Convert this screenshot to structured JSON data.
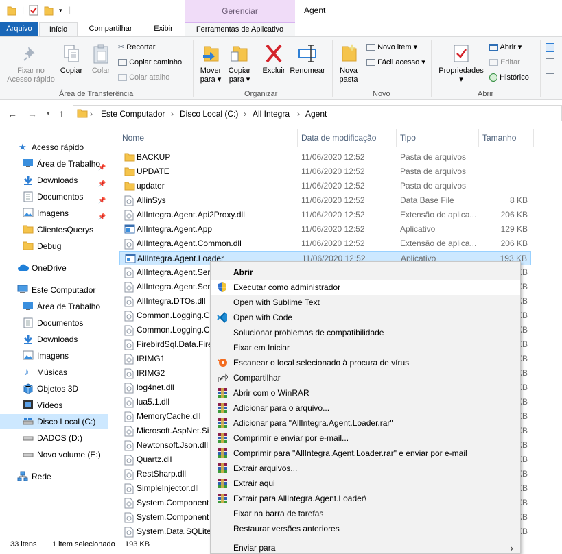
{
  "window": {
    "title": "Agent",
    "context_group": "Gerenciar"
  },
  "tabs": {
    "file": "Arquivo",
    "home": "Início",
    "share": "Compartilhar",
    "view": "Exibir",
    "tools": "Ferramentas de Aplicativo"
  },
  "ribbon": {
    "pin_quick_access": [
      "Fixar no",
      "Acesso rápido"
    ],
    "copy": "Copiar",
    "paste": "Colar",
    "cut": "Recortar",
    "copy_path": "Copiar caminho",
    "paste_shortcut": "Colar atalho",
    "group_clipboard": "Área de Transferência",
    "move_to": [
      "Mover",
      "para"
    ],
    "copy_to": [
      "Copiar",
      "para"
    ],
    "delete": "Excluir",
    "rename": "Renomear",
    "group_organize": "Organizar",
    "new_folder": [
      "Nova",
      "pasta"
    ],
    "new_item": "Novo item",
    "easy_access": "Fácil acesso",
    "group_new": "Novo",
    "properties": "Propriedades",
    "open": "Abrir",
    "edit": "Editar",
    "history": "Histórico",
    "group_open": "Abrir"
  },
  "address": {
    "crumbs": [
      "Este Computador",
      "Disco Local (C:)",
      "All Integra",
      "Agent"
    ]
  },
  "nav": {
    "quick_access": "Acesso rápido",
    "quick_items": [
      "Área de Trabalho",
      "Downloads",
      "Documentos",
      "Imagens",
      "ClientesQuerys",
      "Debug"
    ],
    "onedrive": "OneDrive",
    "this_pc": "Este Computador",
    "pc_items": [
      "Área de Trabalho",
      "Documentos",
      "Downloads",
      "Imagens",
      "Músicas",
      "Objetos 3D",
      "Vídeos",
      "Disco Local (C:)",
      "DADOS (D:)",
      "Novo volume (E:)"
    ],
    "network": "Rede"
  },
  "columns": {
    "name": "Nome",
    "date": "Data de modificação",
    "type": "Tipo",
    "size": "Tamanho"
  },
  "files": [
    {
      "name": "BACKUP",
      "date": "11/06/2020 12:52",
      "type": "Pasta de arquivos",
      "size": ""
    },
    {
      "name": "UPDATE",
      "date": "11/06/2020 12:52",
      "type": "Pasta de arquivos",
      "size": ""
    },
    {
      "name": "updater",
      "date": "11/06/2020 12:52",
      "type": "Pasta de arquivos",
      "size": ""
    },
    {
      "name": "AllinSys",
      "date": "11/06/2020 12:52",
      "type": "Data Base File",
      "size": "8 KB"
    },
    {
      "name": "AllIntegra.Agent.Api2Proxy.dll",
      "date": "11/06/2020 12:52",
      "type": "Extensão de aplica...",
      "size": "206 KB"
    },
    {
      "name": "AllIntegra.Agent.App",
      "date": "11/06/2020 12:52",
      "type": "Aplicativo",
      "size": "129 KB"
    },
    {
      "name": "AllIntegra.Agent.Common.dll",
      "date": "11/06/2020 12:52",
      "type": "Extensão de aplica...",
      "size": "206 KB"
    },
    {
      "name": "AllIntegra.Agent.Loader",
      "date": "11/06/2020 12:52",
      "type": "Aplicativo",
      "size": "193 KB"
    },
    {
      "name": "AllIntegra.Agent.Ser",
      "date": "",
      "type": "",
      "size": "KB"
    },
    {
      "name": "AllIntegra.Agent.Ser",
      "date": "",
      "type": "",
      "size": "KB"
    },
    {
      "name": "AllIntegra.DTOs.dll",
      "date": "",
      "type": "",
      "size": "KB"
    },
    {
      "name": "Common.Logging.C",
      "date": "",
      "type": "",
      "size": "KB"
    },
    {
      "name": "Common.Logging.C",
      "date": "",
      "type": "",
      "size": "KB"
    },
    {
      "name": "FirebirdSql.Data.Fire",
      "date": "",
      "type": "",
      "size": "KB"
    },
    {
      "name": "IRIMG1",
      "date": "",
      "type": "",
      "size": "KB"
    },
    {
      "name": "IRIMG2",
      "date": "",
      "type": "",
      "size": "KB"
    },
    {
      "name": "log4net.dll",
      "date": "",
      "type": "",
      "size": "KB"
    },
    {
      "name": "lua5.1.dll",
      "date": "",
      "type": "",
      "size": "KB"
    },
    {
      "name": "MemoryCache.dll",
      "date": "",
      "type": "",
      "size": "KB"
    },
    {
      "name": "Microsoft.AspNet.Si",
      "date": "",
      "type": "",
      "size": "KB"
    },
    {
      "name": "Newtonsoft.Json.dll",
      "date": "",
      "type": "",
      "size": "KB"
    },
    {
      "name": "Quartz.dll",
      "date": "",
      "type": "",
      "size": "KB"
    },
    {
      "name": "RestSharp.dll",
      "date": "",
      "type": "",
      "size": "KB"
    },
    {
      "name": "SimpleInjector.dll",
      "date": "",
      "type": "",
      "size": "KB"
    },
    {
      "name": "System.Component",
      "date": "",
      "type": "",
      "size": "KB"
    },
    {
      "name": "System.Component",
      "date": "",
      "type": "",
      "size": "KB"
    },
    {
      "name": "System.Data.SQLite.",
      "date": "",
      "type": "",
      "size": "KB"
    }
  ],
  "context_menu": [
    {
      "label": "Abrir",
      "icon": "none"
    },
    {
      "label": "Executar como administrador",
      "icon": "uac-shield-icon"
    },
    {
      "label": "Open with Sublime Text",
      "icon": "none"
    },
    {
      "label": "Open with Code",
      "icon": "vscode-icon"
    },
    {
      "label": "Solucionar problemas de compatibilidade",
      "icon": "none"
    },
    {
      "label": "Fixar em Iniciar",
      "icon": "none"
    },
    {
      "label": "Escanear o local selecionado à procura de vírus",
      "icon": "avast-icon"
    },
    {
      "label": "Compartilhar",
      "icon": "share-icon"
    },
    {
      "label": "Abrir com o WinRAR",
      "icon": "winrar-icon"
    },
    {
      "label": "Adicionar para o arquivo...",
      "icon": "winrar-icon"
    },
    {
      "label": "Adicionar para \"AllIntegra.Agent.Loader.rar\"",
      "icon": "winrar-icon"
    },
    {
      "label": "Comprimir e enviar por e-mail...",
      "icon": "winrar-icon"
    },
    {
      "label": "Comprimir para \"AllIntegra.Agent.Loader.rar\" e enviar por e-mail",
      "icon": "winrar-icon"
    },
    {
      "label": "Extrair arquivos...",
      "icon": "winrar-icon"
    },
    {
      "label": "Extrair aqui",
      "icon": "winrar-icon"
    },
    {
      "label": "Extrair para AllIntegra.Agent.Loader\\",
      "icon": "winrar-icon"
    },
    {
      "label": "Fixar na barra de tarefas",
      "icon": "none"
    },
    {
      "label": "Restaurar versões anteriores",
      "icon": "none"
    },
    {
      "label": "Enviar para",
      "icon": "none"
    }
  ],
  "status": {
    "count": "33 itens",
    "selection": "1 item selecionado",
    "size": "193 KB"
  },
  "colors": {
    "accent": "#1a67b8",
    "selection": "#cce8ff",
    "context_group": "#f0dcf8"
  }
}
